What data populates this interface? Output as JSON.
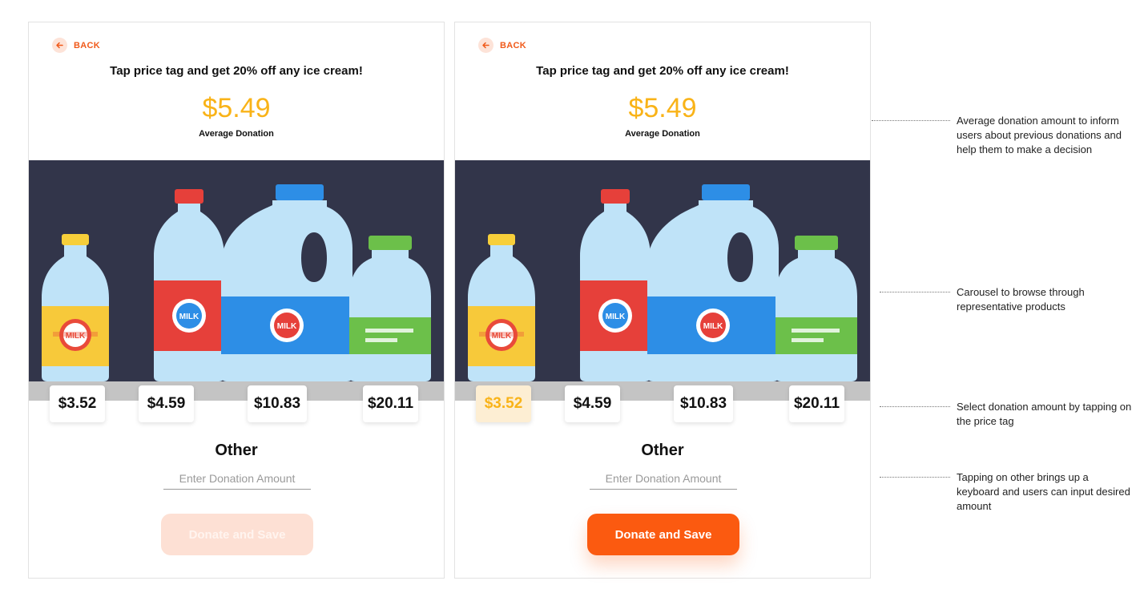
{
  "screens": [
    {
      "back_label": "BACK",
      "headline": "Tap price tag and get 20% off any ice cream!",
      "average_amount": "$5.49",
      "average_label": "Average Donation",
      "price_tags": [
        "$3.52",
        "$4.59",
        "$10.83",
        "$20.11"
      ],
      "selected_tag": null,
      "other_label": "Other",
      "input_placeholder": "Enter Donation Amount",
      "input_value": "",
      "donate_button_label": "Donate and Save",
      "donate_button_state": "disabled"
    },
    {
      "back_label": "BACK",
      "headline": "Tap price tag and get 20% off any ice cream!",
      "average_amount": "$5.49",
      "average_label": "Average Donation",
      "price_tags": [
        "$3.52",
        "$4.59",
        "$10.83",
        "$20.11"
      ],
      "selected_tag": 0,
      "other_label": "Other",
      "input_placeholder": "Enter Donation Amount",
      "input_value": "",
      "donate_button_label": "Donate and Save",
      "donate_button_state": "active"
    }
  ],
  "product_labels": [
    "MILK",
    "MILK",
    "MILK",
    ""
  ],
  "annotations": [
    "Average donation amount to inform users about previous donations and help them to make a decision",
    "Carousel to browse through representative products",
    "Select donation amount by tapping on the price tag",
    "Tapping on other brings up a keyboard and users can input desired amount"
  ],
  "colors": {
    "accent": "#fb5a10",
    "amount_yellow": "#f9b318",
    "carousel_bg": "#32354a",
    "selected_tag_bg": "#fdeed3"
  },
  "icons": {
    "back": "arrow-left-icon",
    "carousel_prev": "chevron-left-icon",
    "carousel_next": "chevron-right-icon"
  }
}
